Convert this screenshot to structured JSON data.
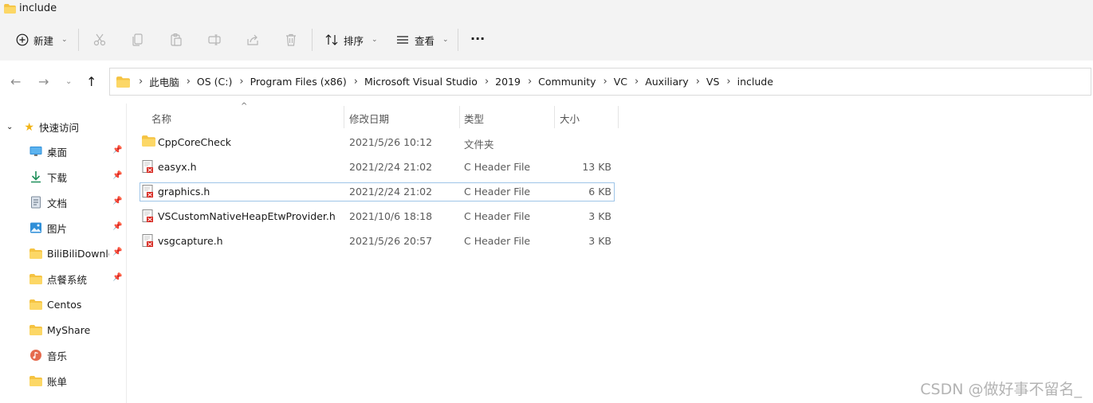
{
  "window": {
    "title": "include"
  },
  "toolbar": {
    "new_label": "新建",
    "sort_label": "排序",
    "view_label": "查看",
    "more_label": "···",
    "icons": [
      "cut-icon",
      "copy-icon",
      "paste-icon",
      "rename-icon",
      "share-icon",
      "delete-icon"
    ]
  },
  "address": {
    "crumbs": [
      "此电脑",
      "OS (C:)",
      "Program Files (x86)",
      "Microsoft Visual Studio",
      "2019",
      "Community",
      "VC",
      "Auxiliary",
      "VS",
      "include"
    ]
  },
  "sidebar": {
    "quick_access": "快速访问",
    "items": [
      {
        "label": "桌面",
        "icon": "desktop-icon",
        "pinned": true
      },
      {
        "label": "下载",
        "icon": "download-icon",
        "pinned": true
      },
      {
        "label": "文档",
        "icon": "document-icon",
        "pinned": true
      },
      {
        "label": "图片",
        "icon": "pictures-icon",
        "pinned": true
      },
      {
        "label": "BiliBiliDownload",
        "icon": "folder-icon",
        "pinned": true
      },
      {
        "label": "点餐系统",
        "icon": "folder-icon",
        "pinned": true
      },
      {
        "label": "Centos",
        "icon": "folder-icon",
        "pinned": false
      },
      {
        "label": "MyShare",
        "icon": "folder-icon",
        "pinned": false
      },
      {
        "label": "音乐",
        "icon": "music-icon",
        "pinned": false
      },
      {
        "label": "账单",
        "icon": "folder-icon",
        "pinned": false
      }
    ]
  },
  "list": {
    "columns": [
      "名称",
      "修改日期",
      "类型",
      "大小"
    ],
    "rows": [
      {
        "name": "CppCoreCheck",
        "date": "2021/5/26 10:12",
        "type": "文件夹",
        "size": "",
        "icon": "folder-icon"
      },
      {
        "name": "easyx.h",
        "date": "2021/2/24 21:02",
        "type": "C Header File",
        "size": "13 KB",
        "icon": "header-file-icon"
      },
      {
        "name": "graphics.h",
        "date": "2021/2/24 21:02",
        "type": "C Header File",
        "size": "6 KB",
        "icon": "header-file-icon",
        "selected": true
      },
      {
        "name": "VSCustomNativeHeapEtwProvider.h",
        "date": "2021/10/6 18:18",
        "type": "C Header File",
        "size": "3 KB",
        "icon": "header-file-icon"
      },
      {
        "name": "vsgcapture.h",
        "date": "2021/5/26 20:57",
        "type": "C Header File",
        "size": "3 KB",
        "icon": "header-file-icon"
      }
    ]
  },
  "watermark": "CSDN @做好事不留名_",
  "colors": {
    "folder": "#f5c342",
    "accent": "#0067c0",
    "selection_border": "#9ec5e8"
  }
}
